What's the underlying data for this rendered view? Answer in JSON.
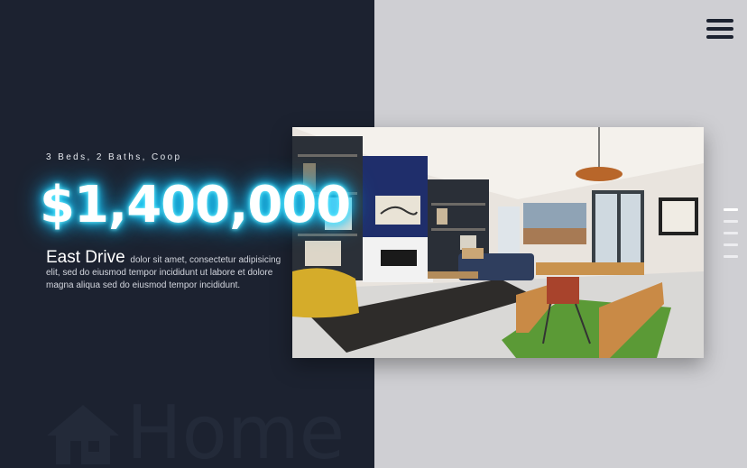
{
  "listing": {
    "specs": "3 Beds, 2 Baths, Coop",
    "price": "$1,400,000",
    "street": "East Drive",
    "description": "dolor sit amet, consectetur adipisicing elit, sed do eiusmod tempor incididunt ut labore et dolore magna aliqua sed do eiusmod tempor incididunt."
  },
  "watermark": {
    "text": "Home",
    "icon": "house-icon"
  },
  "menu": {
    "icon": "hamburger-menu-icon"
  },
  "pager": {
    "slides": 5,
    "active_index": 0
  },
  "colors": {
    "left_panel": "#1c2230",
    "right_panel": "#cfcfd3",
    "price_glow": "#1fd7ff"
  }
}
